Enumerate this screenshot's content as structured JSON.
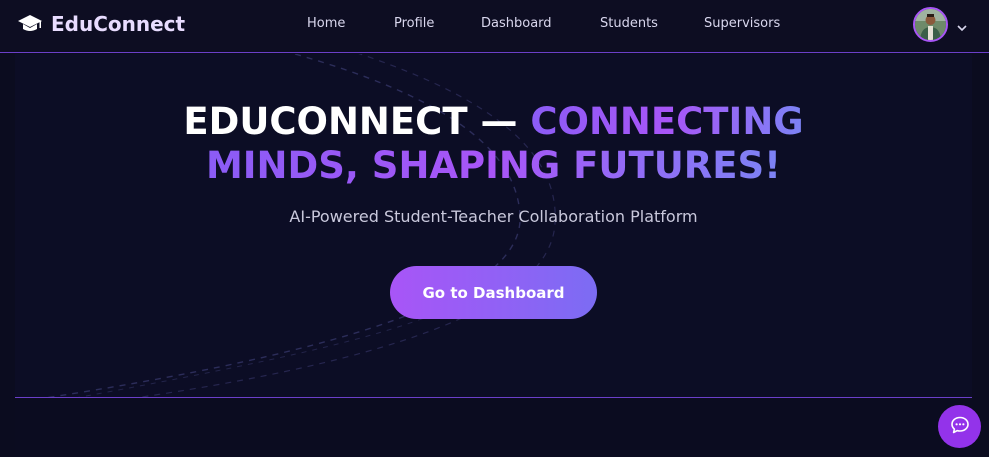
{
  "brand": {
    "name": "EduConnect",
    "icon": "graduation-cap-icon"
  },
  "nav": {
    "links": [
      "Home",
      "Profile",
      "Dashboard",
      "Students",
      "Supervisors"
    ]
  },
  "user": {
    "avatar": "user-avatar",
    "menu_icon": "chevron-down-icon"
  },
  "hero": {
    "headline_part1": "EDUCONNECT — ",
    "headline_part2": "CONNECTING",
    "headline_line2": "MINDS, SHAPING FUTURES!",
    "subtitle": "AI-Powered Student-Teacher Collaboration Platform",
    "cta_label": "Go to Dashboard"
  },
  "chat": {
    "icon": "chat-bubble-icon"
  },
  "colors": {
    "accent": "#a855f7",
    "accent_secondary": "#7c83f5",
    "background": "#0c0d25",
    "border": "#6b3fc9"
  }
}
